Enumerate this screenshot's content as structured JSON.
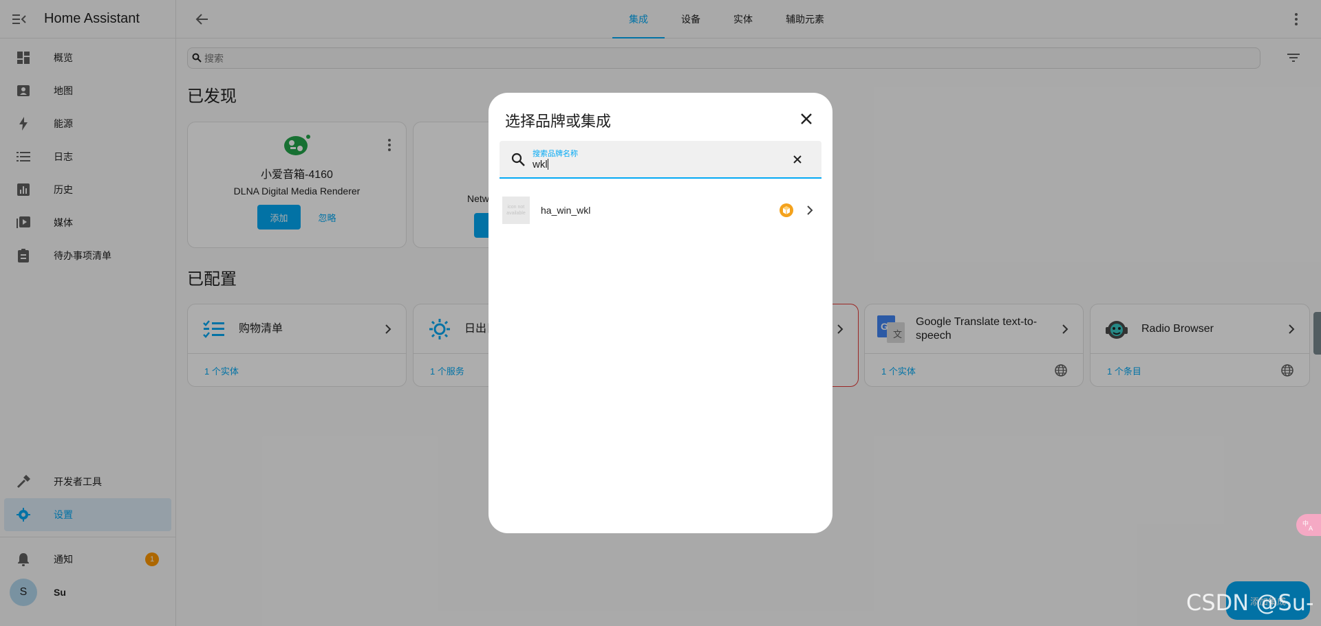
{
  "app": {
    "title": "Home Assistant"
  },
  "sidebar": {
    "items": [
      {
        "label": "概览",
        "icon": "dashboard-icon"
      },
      {
        "label": "地图",
        "icon": "map-icon"
      },
      {
        "label": "能源",
        "icon": "lightning-icon"
      },
      {
        "label": "日志",
        "icon": "list-icon"
      },
      {
        "label": "历史",
        "icon": "chart-icon"
      },
      {
        "label": "媒体",
        "icon": "media-icon"
      },
      {
        "label": "待办事项清单",
        "icon": "clipboard-icon"
      }
    ],
    "dev_tools": "开发者工具",
    "settings": "设置",
    "notifications": "通知",
    "notification_count": "1",
    "user_initial": "S",
    "user_name": "Su"
  },
  "header": {
    "tabs": [
      {
        "label": "集成",
        "active": true
      },
      {
        "label": "设备",
        "active": false
      },
      {
        "label": "实体",
        "active": false
      },
      {
        "label": "辅助元素",
        "active": false
      }
    ]
  },
  "search": {
    "placeholder": "搜索"
  },
  "discovered": {
    "title": "已发现",
    "cards": [
      {
        "name": "小爱音箱-4160",
        "subtitle": "DLNA Digital Media Renderer",
        "add": "添加",
        "ignore": "忽略"
      },
      {
        "name": "",
        "subtitle": "Netw",
        "add": "",
        "ignore": ""
      }
    ]
  },
  "configured": {
    "title": "已配置",
    "cards": [
      {
        "title": "购物清单",
        "footer": "1 个实体",
        "icon": "checklist-icon",
        "cloud": false
      },
      {
        "title": "日出日",
        "footer": "1 个服务",
        "icon": "sun-icon",
        "cloud": false
      },
      {
        "title": "Google Translate text-to-speech",
        "footer": "1 个实体",
        "icon": "google-translate-icon",
        "cloud": true
      },
      {
        "title": "Radio Browser",
        "footer": "1 个条目",
        "icon": "radio-icon",
        "cloud": true
      }
    ]
  },
  "dialog": {
    "title": "选择品牌或集成",
    "search_label": "搜索品牌名称",
    "search_value": "wkl",
    "results": [
      {
        "name": "ha_win_wkl",
        "thumb_text": "icon not available",
        "custom": true
      }
    ]
  },
  "fab": {
    "label": "添加集成"
  },
  "watermark": "CSDN @Su-",
  "colors": {
    "accent": "#03a9f4",
    "badge": "#ff9800",
    "custom": "#f4a21c"
  }
}
